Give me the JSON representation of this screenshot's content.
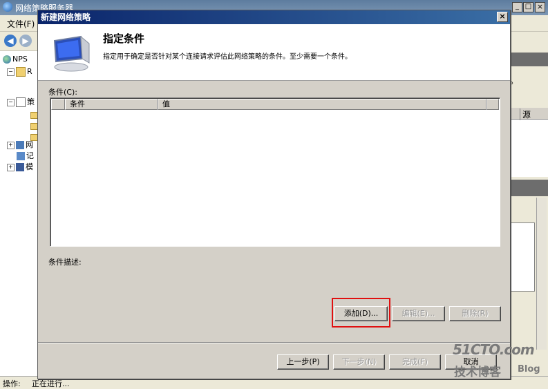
{
  "background": {
    "title": "网络策略服务器",
    "menu_file": "文件(F)",
    "tree": [
      {
        "label": "NPS"
      },
      {
        "label": "R"
      },
      {
        "label": "策"
      },
      {
        "label": "网"
      },
      {
        "label": "记"
      },
      {
        "label": "模"
      }
    ],
    "right_fragments": {
      "dot": "。",
      "col1": "源"
    },
    "status_label": "操作:",
    "status_text": "正在进行..."
  },
  "dialog": {
    "title": "新建网络策略",
    "close_glyph": "×",
    "header_title": "指定条件",
    "header_desc": "指定用于确定是否针对某个连接请求评估此网络策略的条件。至少需要一个条件。",
    "conditions_label": "条件(C):",
    "columns": [
      "条件",
      "值"
    ],
    "description_label": "条件描述:",
    "buttons": {
      "add": "添加(D)...",
      "edit": "编辑(E)...",
      "delete": "删除(R)",
      "back": "上一步(P)",
      "next": "下一步(N)",
      "finish": "完成(F)",
      "cancel": "取消"
    }
  },
  "watermark": {
    "line1": "51CTO.com",
    "line2": "技术博客",
    "line3": "Blog"
  },
  "colors": {
    "title_bar": "#0a246a",
    "highlight": "#e01010",
    "dialog_bg": "#d4d0c8"
  }
}
